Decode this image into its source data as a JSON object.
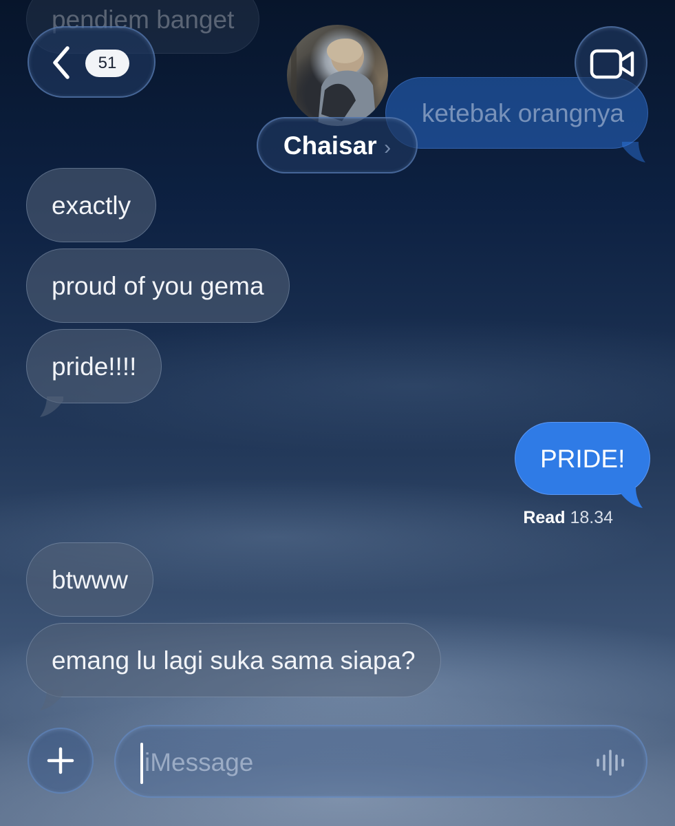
{
  "header": {
    "back_badge": "51",
    "contact_name": "Chaisar"
  },
  "messages": [
    {
      "text": "pendiem banget",
      "direction": "incoming",
      "partially_hidden": true
    },
    {
      "text": "ketebak orangnya",
      "direction": "outgoing",
      "partially_hidden": true
    },
    {
      "text": "exactly",
      "direction": "incoming"
    },
    {
      "text": "proud of you gema",
      "direction": "incoming"
    },
    {
      "text": "pride!!!!",
      "direction": "incoming"
    },
    {
      "text": "PRIDE!",
      "direction": "outgoing"
    },
    {
      "text": "btwww",
      "direction": "incoming"
    },
    {
      "text": "emang lu lagi suka sama siapa?",
      "direction": "incoming"
    }
  ],
  "read_receipt": {
    "label": "Read",
    "time": "18.34"
  },
  "composer": {
    "placeholder": "iMessage"
  },
  "icons": {
    "back": "chevron-left-icon",
    "video": "video-camera-icon",
    "add": "plus-icon",
    "audio": "waveform-icon",
    "avatar": "contact-photo"
  },
  "colors": {
    "outgoing_bubble": "#2f7be6",
    "incoming_bubble": "#55647a",
    "accent_border": "#6e96d2"
  }
}
